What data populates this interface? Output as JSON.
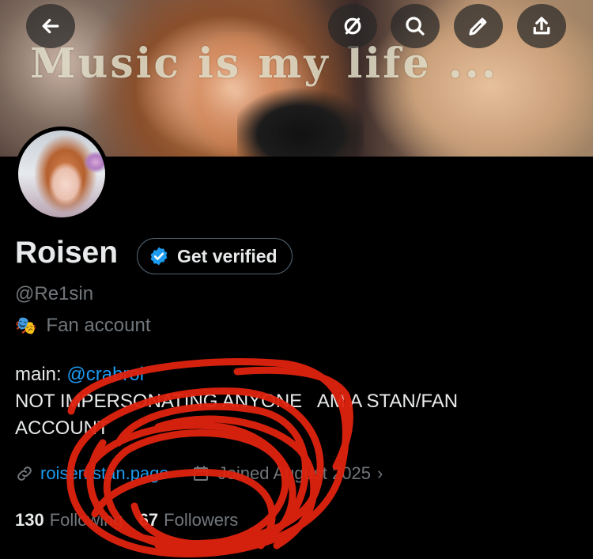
{
  "banner": {
    "overlay_text": "Music is my life ..."
  },
  "top_bar": {
    "back_icon": "arrow-left-icon",
    "buttons": [
      {
        "name": "grok-icon"
      },
      {
        "name": "search-icon"
      },
      {
        "name": "pencil-icon"
      },
      {
        "name": "share-icon"
      }
    ]
  },
  "profile": {
    "display_name": "Roisen",
    "get_verified_label": "Get verified",
    "handle": "@Re1sin",
    "category": "Fan account",
    "bio_prefix": "main: ",
    "bio_mention": "@crabroi",
    "bio_line2": "NOT IMPERSONATING ANYONE   AM A STAN/FAN",
    "bio_line3": "ACCOUNT",
    "website": "roisen.stan.page",
    "joined": "Joined August 2025",
    "following_count": "130",
    "following_label": "Following",
    "followers_count": "67",
    "followers_label": "Followers"
  },
  "colors": {
    "accent": "#1d9bf0",
    "background": "#000000",
    "secondary_text": "#71767b",
    "scribble": "#e0230f"
  }
}
